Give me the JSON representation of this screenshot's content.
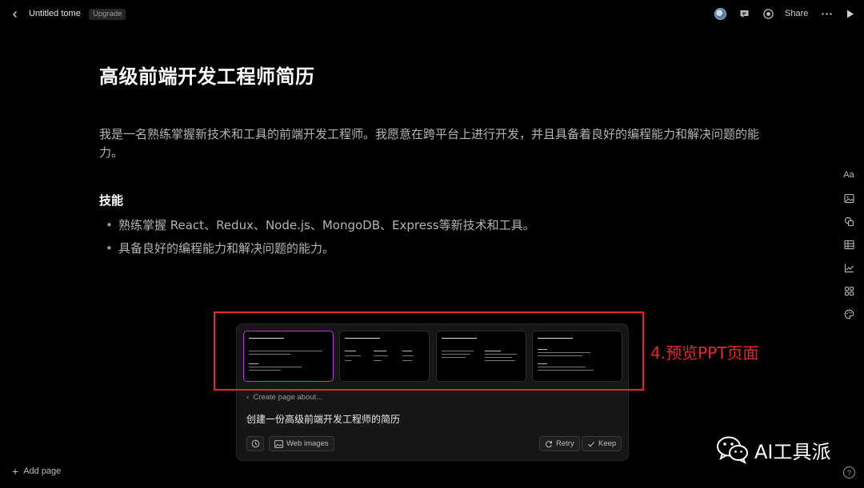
{
  "topbar": {
    "doc_title": "Untitled tome",
    "upgrade_label": "Upgrade",
    "share_label": "Share"
  },
  "document": {
    "title": "高级前端开发工程师简历",
    "intro": "我是一名熟练掌握新技术和工具的前端开发工程师。我愿意在跨平台上进行开发，并且具备着良好的编程能力和解决问题的能力。",
    "skills_heading": "技能",
    "skills": [
      "熟练掌握 React、Redux、Node.js、MongoDB、Express等新技术和工具。",
      "具备良好的编程能力和解决问题的能力。"
    ]
  },
  "rail": {
    "text_label": "Aa",
    "icons": [
      "text-icon",
      "image-icon",
      "shapes-icon",
      "table-icon",
      "chart-icon",
      "apps-icon",
      "palette-icon"
    ]
  },
  "panel": {
    "create_label": "Create page about...",
    "prompt": "创建一份高级前端开发工程师的简历",
    "web_images_label": "Web images",
    "retry_label": "Retry",
    "keep_label": "Keep",
    "selected_thumbnail": 1
  },
  "annotation": {
    "label": "4.预览PPT页面",
    "color": "#e8262b"
  },
  "bottom": {
    "add_page_label": "Add page",
    "help_label": "?"
  },
  "watermark": {
    "text": "AI工具派"
  },
  "colors": {
    "background": "#000000",
    "panel": "#161616",
    "selected_border": "#b43cd8",
    "body_text": "#b3b3b3"
  }
}
